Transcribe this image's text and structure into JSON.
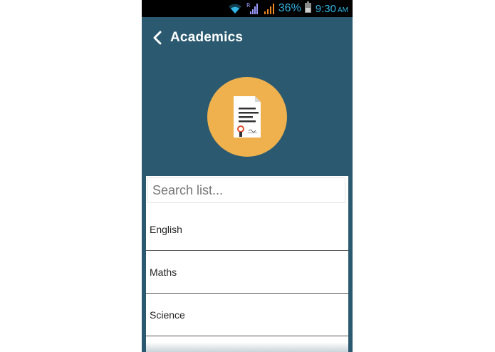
{
  "status_bar": {
    "battery_percent": "36%",
    "time": "9:30",
    "ampm": "AM",
    "roaming_indicator": "R",
    "accent_color": "#33b5e5"
  },
  "app_bar": {
    "title": "Academics",
    "background_color": "#2b5a70"
  },
  "hero": {
    "icon": "certificate-document-icon",
    "circle_color": "#efb14e"
  },
  "search": {
    "placeholder": "Search list..."
  },
  "list": {
    "items": [
      {
        "label": "English"
      },
      {
        "label": "Maths"
      },
      {
        "label": "Science"
      }
    ]
  }
}
